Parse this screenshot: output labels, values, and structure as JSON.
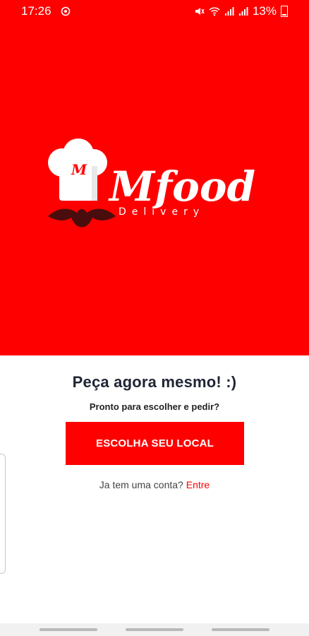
{
  "status": {
    "time": "17:26",
    "battery": "13%"
  },
  "logo": {
    "chef_letter": "M",
    "brand": "Mfood",
    "tagline": "Delivery"
  },
  "main": {
    "headline": "Peça agora mesmo! :)",
    "subheadline": "Pronto para escolher e pedir?",
    "cta_label": "ESCOLHA SEU LOCAL",
    "login_prompt": "Ja tem uma conta?",
    "login_link": "Entre"
  },
  "colors": {
    "brand_red": "#ff0000",
    "headline": "#1f2534"
  }
}
